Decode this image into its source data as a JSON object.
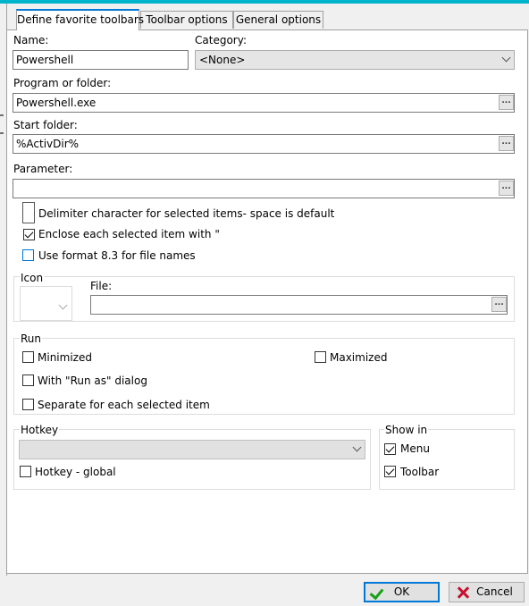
{
  "tabs": [
    {
      "label": "Define favorite toolbars",
      "active": true
    },
    {
      "label": "Toolbar options",
      "active": false
    },
    {
      "label": "General options",
      "active": false
    }
  ],
  "form": {
    "name_label": "Name:",
    "name_value": "Powershell",
    "category_label": "Category:",
    "category_value": "<None>",
    "program_label": "Program or folder:",
    "program_value": "Powershell.exe",
    "start_folder_label": "Start folder:",
    "start_folder_value": "%ActivDir%",
    "parameter_label": "Parameter:",
    "parameter_value": "",
    "browse_label": "..."
  },
  "options": {
    "delimiter_label": "Delimiter character for selected items- space is default",
    "delimiter_value": "",
    "enclose_label": "Enclose each selected item with \"",
    "enclose_checked": true,
    "format83_label": "Use format 8.3 for file names",
    "format83_checked": false
  },
  "icon": {
    "group_label": "Icon",
    "file_label": "File:",
    "file_value": ""
  },
  "run": {
    "group_label": "Run",
    "minimized_label": "Minimized",
    "maximized_label": "Maximized",
    "runas_label": "With \"Run as\" dialog",
    "separate_label": "Separate for each selected item"
  },
  "hotkey": {
    "group_label": "Hotkey",
    "value": "",
    "global_label": "Hotkey - global"
  },
  "show_in": {
    "group_label": "Show in",
    "menu_label": "Menu",
    "menu_checked": true,
    "toolbar_label": "Toolbar",
    "toolbar_checked": true
  },
  "buttons": {
    "ok_label": "OK",
    "cancel_label": "Cancel"
  },
  "colors": {
    "accent": "#0078d7",
    "top_strip": "#00b4cc",
    "ok_icon": "#16a016",
    "cancel_icon": "#c8102e"
  }
}
